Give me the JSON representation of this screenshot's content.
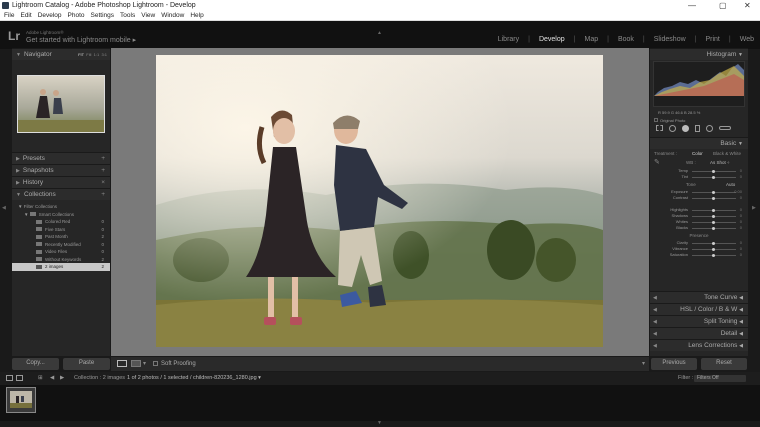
{
  "window": {
    "title": "Lightroom Catalog - Adobe Photoshop Lightroom - Develop",
    "min": "—",
    "max": "▢",
    "close": "✕"
  },
  "menu": [
    "File",
    "Edit",
    "Develop",
    "Photo",
    "Settings",
    "Tools",
    "View",
    "Window",
    "Help"
  ],
  "identity": {
    "logo": "Lr",
    "line1": "Adobe Lightroom®",
    "line2": "Get started with Lightroom mobile ▸"
  },
  "modules": [
    "Library",
    "Develop",
    "Map",
    "Book",
    "Slideshow",
    "Print",
    "Web"
  ],
  "active_module": "Develop",
  "left": {
    "navigator": {
      "label": "Navigator",
      "zoom": [
        "FIT",
        "Fill",
        "1:1",
        "3:1"
      ]
    },
    "panels": [
      "Presets",
      "Snapshots",
      "History",
      "Collections"
    ],
    "collections": [
      {
        "name": "Filter Collections",
        "count": ""
      },
      {
        "name": "Smart Collections",
        "count": ""
      },
      {
        "name": "Colored Red",
        "count": "0"
      },
      {
        "name": "Five Stars",
        "count": "0"
      },
      {
        "name": "Past Month",
        "count": "2"
      },
      {
        "name": "Recently Modified",
        "count": "0"
      },
      {
        "name": "Video Files",
        "count": "0"
      },
      {
        "name": "Without Keywords",
        "count": "2"
      },
      {
        "name": "2 images",
        "count": "2"
      }
    ],
    "copy": "Copy...",
    "paste": "Paste"
  },
  "toolbar": {
    "soft_proofing": "Soft Proofing"
  },
  "right": {
    "histogram": "Histogram",
    "histo_readout": "R  59.9  G  46.6  B  28.5  %",
    "original_photo": "Original Photo",
    "basic": "Basic",
    "treatment_label": "Treatment :",
    "color": "Color",
    "bw": "Black & White",
    "profile": "As Shot ÷",
    "wb_label": "WB :",
    "temp": "Temp",
    "tint": "Tint",
    "tone": "Tone",
    "auto": "Auto",
    "tone_sliders": [
      "Exposure",
      "Contrast"
    ],
    "tone_sliders2": [
      "Highlights",
      "Shadows",
      "Whites",
      "Blacks"
    ],
    "presence": "Presence",
    "presence_sliders": [
      "Clarity",
      "Vibrance",
      "Saturation"
    ],
    "panels": [
      "Tone Curve",
      "HSL / Color / B & W",
      "Split Toning",
      "Detail",
      "Lens Corrections"
    ],
    "previous": "Previous",
    "reset": "Reset"
  },
  "filmbar": {
    "pages": "1  2",
    "collection": "Collection : 2 images",
    "info": "1 of 2 photos / 1 selected / children-820236_1280.jpg ▾",
    "filter_label": "Filter :",
    "filter_value": "Filters Off"
  }
}
